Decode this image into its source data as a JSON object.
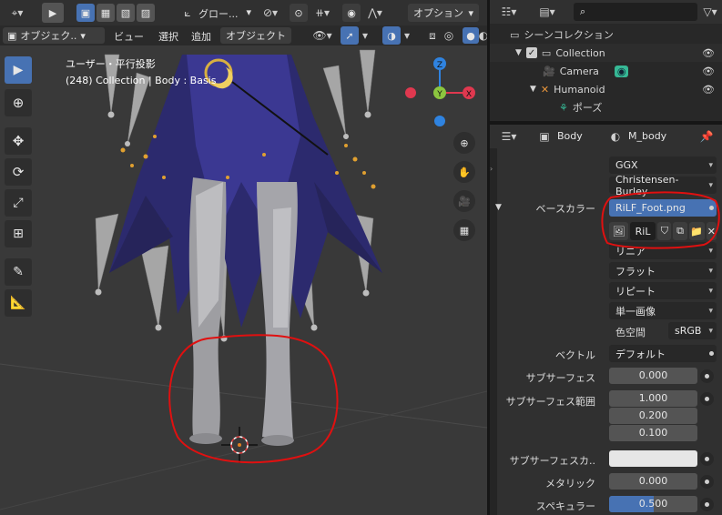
{
  "viewport_header": {
    "global_label": "グロー...",
    "options_label": "オプション"
  },
  "viewport_menu": {
    "mode_label": "オブジェク..",
    "items": [
      "ビュー",
      "選択",
      "追加",
      "オブジェクト"
    ]
  },
  "viewport_overlay": {
    "view_name": "ユーザー・平行投影",
    "collection_info": "(248) Collection | Body : Basis"
  },
  "gizmo": {
    "z": "Z",
    "y": "Y",
    "x": "X"
  },
  "outliner": {
    "search_placeholder": "",
    "items": [
      "シーンコレクション",
      "Collection",
      "Camera",
      "Humanoid",
      "ポーズ"
    ]
  },
  "properties_header": {
    "object_name": "Body",
    "material_name": "M_body"
  },
  "properties": {
    "dropdowns": [
      "GGX",
      "Christensen-Burley"
    ],
    "base_color_label": "ベースカラー",
    "image_name": "RiLF_Foot.png",
    "image_short": "RiL",
    "image_dropdowns": [
      "リニア",
      "フラット",
      "リピート",
      "単一画像"
    ],
    "colorspace_label": "色空間",
    "colorspace_value": "sRGB",
    "vector_label": "ベクトル",
    "vector_value": "デフォルト",
    "subsurface_label": "サブサーフェス",
    "subsurface_value": "0.000",
    "subsurface_radius_label": "サブサーフェス範囲",
    "subsurface_radius": [
      "1.000",
      "0.200",
      "0.100"
    ],
    "subsurface_color_label": "サブサーフェスカ..",
    "metallic_label": "メタリック",
    "metallic_value": "0.000",
    "specular_label": "スペキュラー",
    "specular_value": "0.500",
    "specular_fill": 0.5
  },
  "colors": {
    "accent_blue": "#4772b3",
    "annotation_red": "#e01010",
    "gizmo_x": "#e0384f",
    "gizmo_y": "#8cc63f",
    "gizmo_z": "#2f83e0",
    "camera_green": "#36b895"
  }
}
